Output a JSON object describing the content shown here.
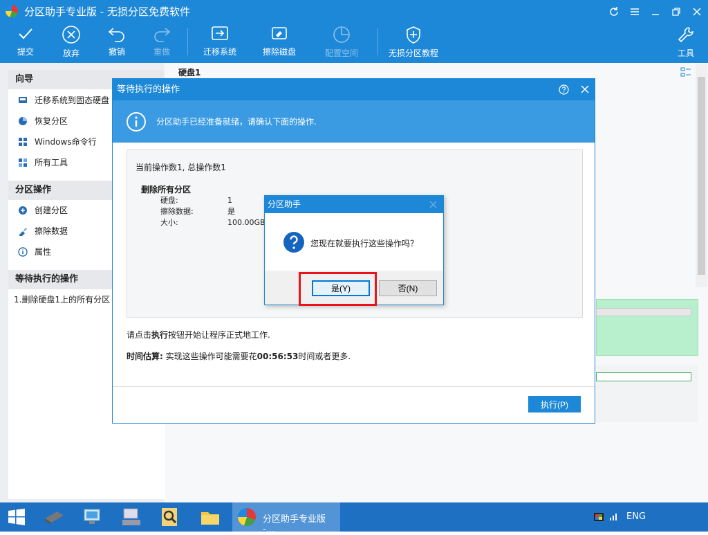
{
  "app": {
    "title": "分区助手专业版 - 无损分区免费软件"
  },
  "toolbar": {
    "items": [
      {
        "label": "提交",
        "icon": "check-icon",
        "enabled": true
      },
      {
        "label": "放弃",
        "icon": "close-circle-icon",
        "enabled": true
      },
      {
        "label": "撤销",
        "icon": "undo-icon",
        "enabled": true
      },
      {
        "label": "重做",
        "icon": "redo-icon",
        "enabled": false
      },
      {
        "label": "迁移系统",
        "icon": "migrate-system-icon",
        "enabled": true
      },
      {
        "label": "擦除磁盘",
        "icon": "wipe-disk-icon",
        "enabled": true
      },
      {
        "label": "配置空间",
        "icon": "allocate-space-icon",
        "enabled": false
      },
      {
        "label": "无损分区教程",
        "icon": "shield-icon",
        "enabled": true
      },
      {
        "label": "工具",
        "icon": "wrench-icon",
        "enabled": true
      }
    ]
  },
  "sidebar": {
    "wizard": {
      "header": "向导",
      "items": [
        {
          "label": "迁移系统到固态硬盘"
        },
        {
          "label": "恢复分区"
        },
        {
          "label": "Windows命令行"
        },
        {
          "label": "所有工具"
        }
      ]
    },
    "partition_ops": {
      "header": "分区操作",
      "items": [
        {
          "label": "创建分区"
        },
        {
          "label": "擦除数据"
        },
        {
          "label": "属性"
        }
      ]
    },
    "pending": {
      "header": "等待执行的操作",
      "items": [
        {
          "label": "1.删除硬盘1上的所有分区"
        }
      ]
    }
  },
  "main": {
    "disk_label": "硬盘1"
  },
  "pending_dialog": {
    "title": "等待执行的操作",
    "banner": "分区助手已经准备就绪，请确认下面的操作.",
    "op_count": "当前操作数1,  总操作数1",
    "op_title": "删除所有分区",
    "details": [
      {
        "key": "硬盘:",
        "value": "1"
      },
      {
        "key": "擦除数据:",
        "value": "是"
      },
      {
        "key": "大小:",
        "value": "100.00GB"
      }
    ],
    "hint_prefix": "请点击",
    "hint_bold": "执行",
    "hint_suffix": "按钮开始让程序正式地工作.",
    "estimate_label": "时间估算:",
    "estimate_text": " 实现这些操作可能需要花",
    "estimate_time": "00:56:53",
    "estimate_suffix": "时间或者更多.",
    "execute_button": "执行(P)"
  },
  "confirm_box": {
    "title": "分区助手",
    "message": "您现在就要执行这些操作吗？",
    "yes_button": "是(Y)",
    "no_button": "否(N)"
  },
  "taskbar": {
    "active_app": "分区助手专业版 -...",
    "language": "ENG"
  }
}
